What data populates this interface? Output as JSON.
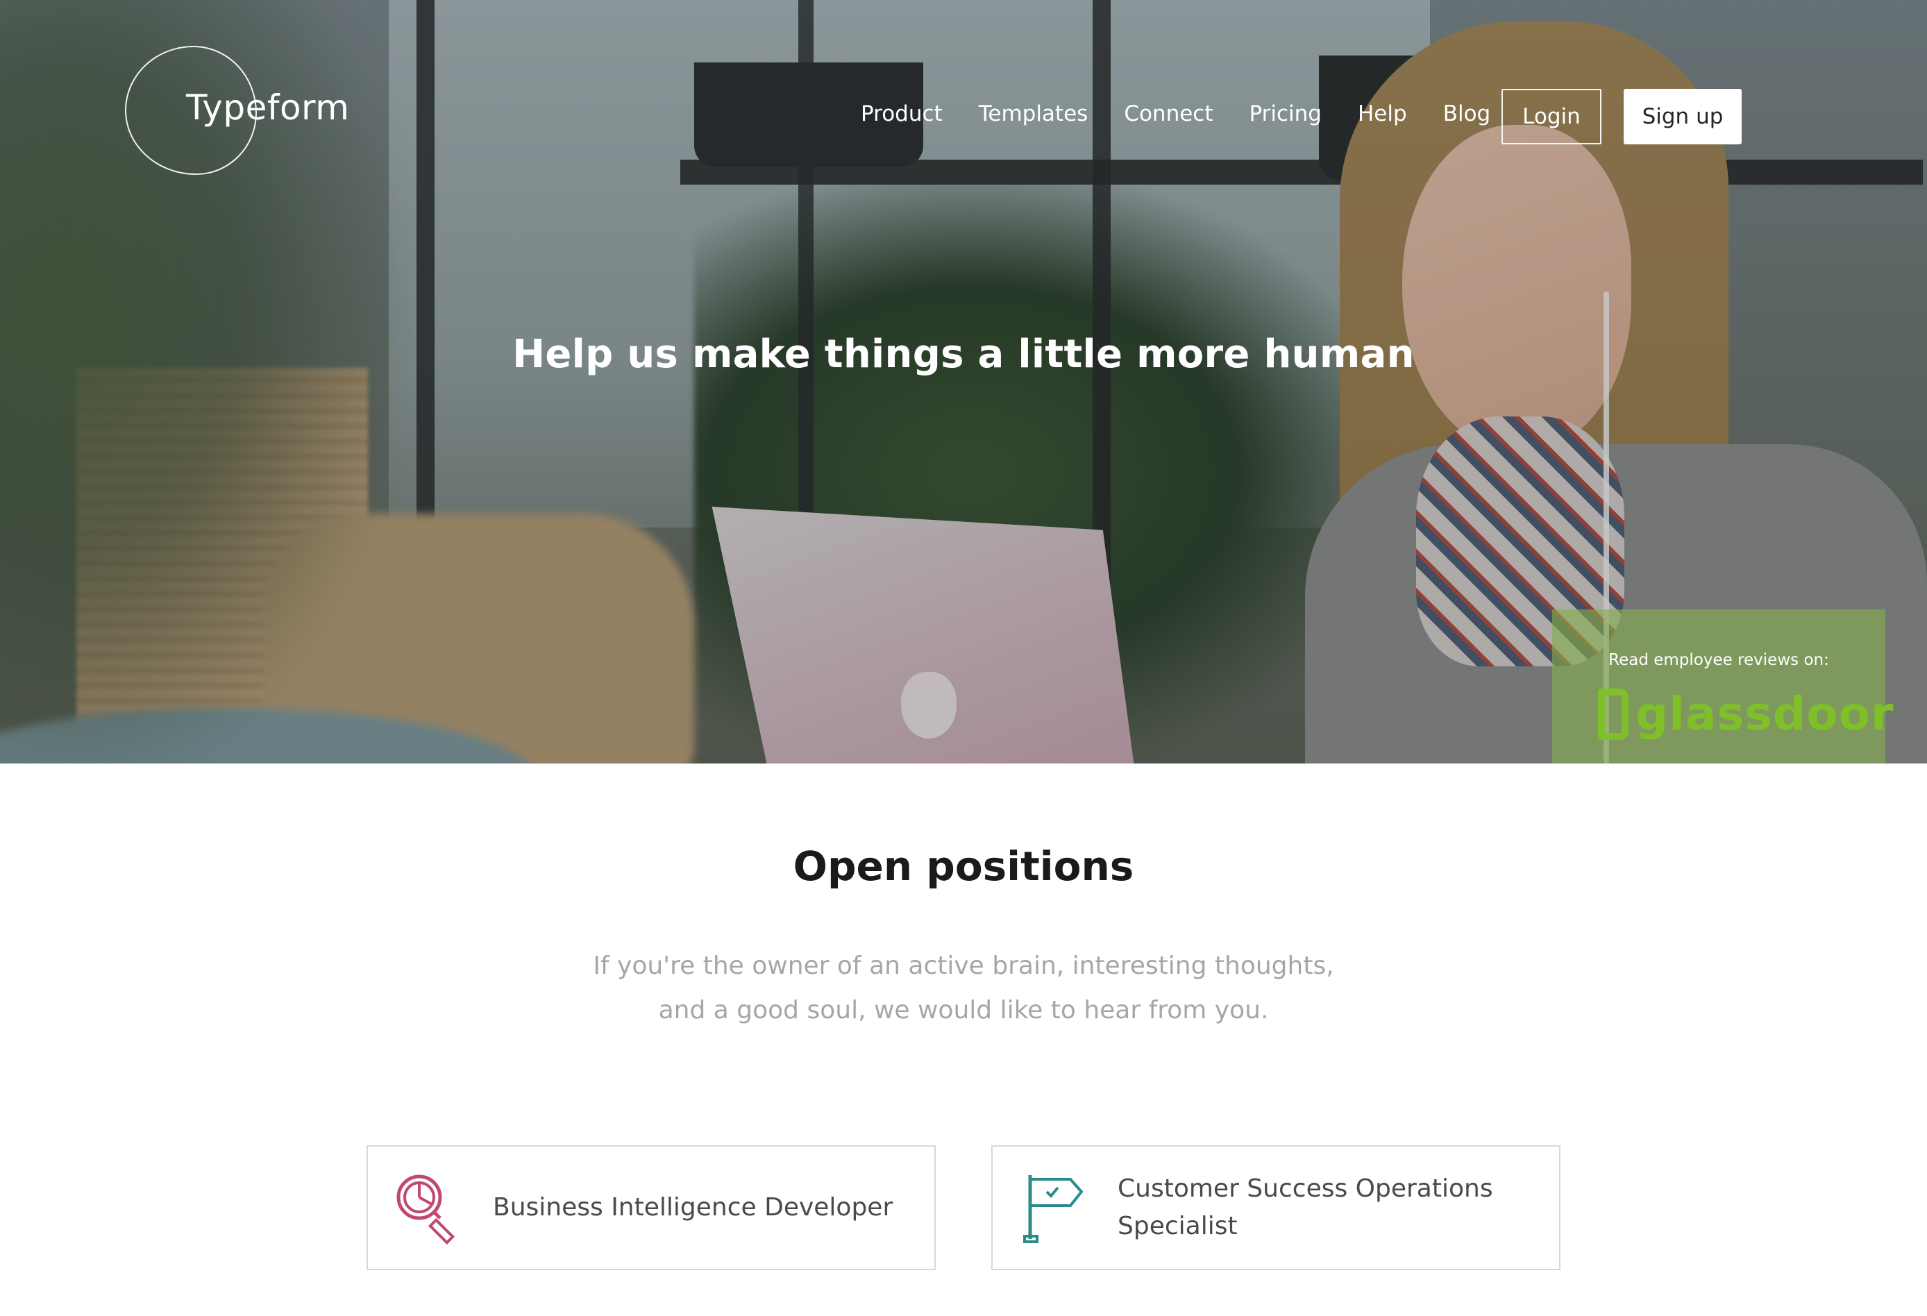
{
  "brand": {
    "name": "Typeform"
  },
  "nav": {
    "items": [
      {
        "label": "Product"
      },
      {
        "label": "Templates"
      },
      {
        "label": "Connect"
      },
      {
        "label": "Pricing"
      },
      {
        "label": "Help"
      },
      {
        "label": "Blog"
      }
    ],
    "login_label": "Login",
    "signup_label": "Sign up"
  },
  "hero": {
    "title": "Help us make things a little more human"
  },
  "glassdoor": {
    "caption": "Read employee reviews on:",
    "logo_text": "glassdoor",
    "color": "#7fbf2a"
  },
  "positions": {
    "title": "Open positions",
    "subtitle_line1": "If you're the owner of an active brain, interesting thoughts,",
    "subtitle_line2": "and a good soul, we would like to hear from you.",
    "cards": [
      {
        "label": "Business Intelligence Developer",
        "icon": "magnifier-chart-icon",
        "icon_color": "#c04a6e"
      },
      {
        "label_line1": "Customer Success Operations",
        "label_line2": "Specialist",
        "icon": "flag-check-icon",
        "icon_color": "#2b8a8a"
      }
    ]
  }
}
